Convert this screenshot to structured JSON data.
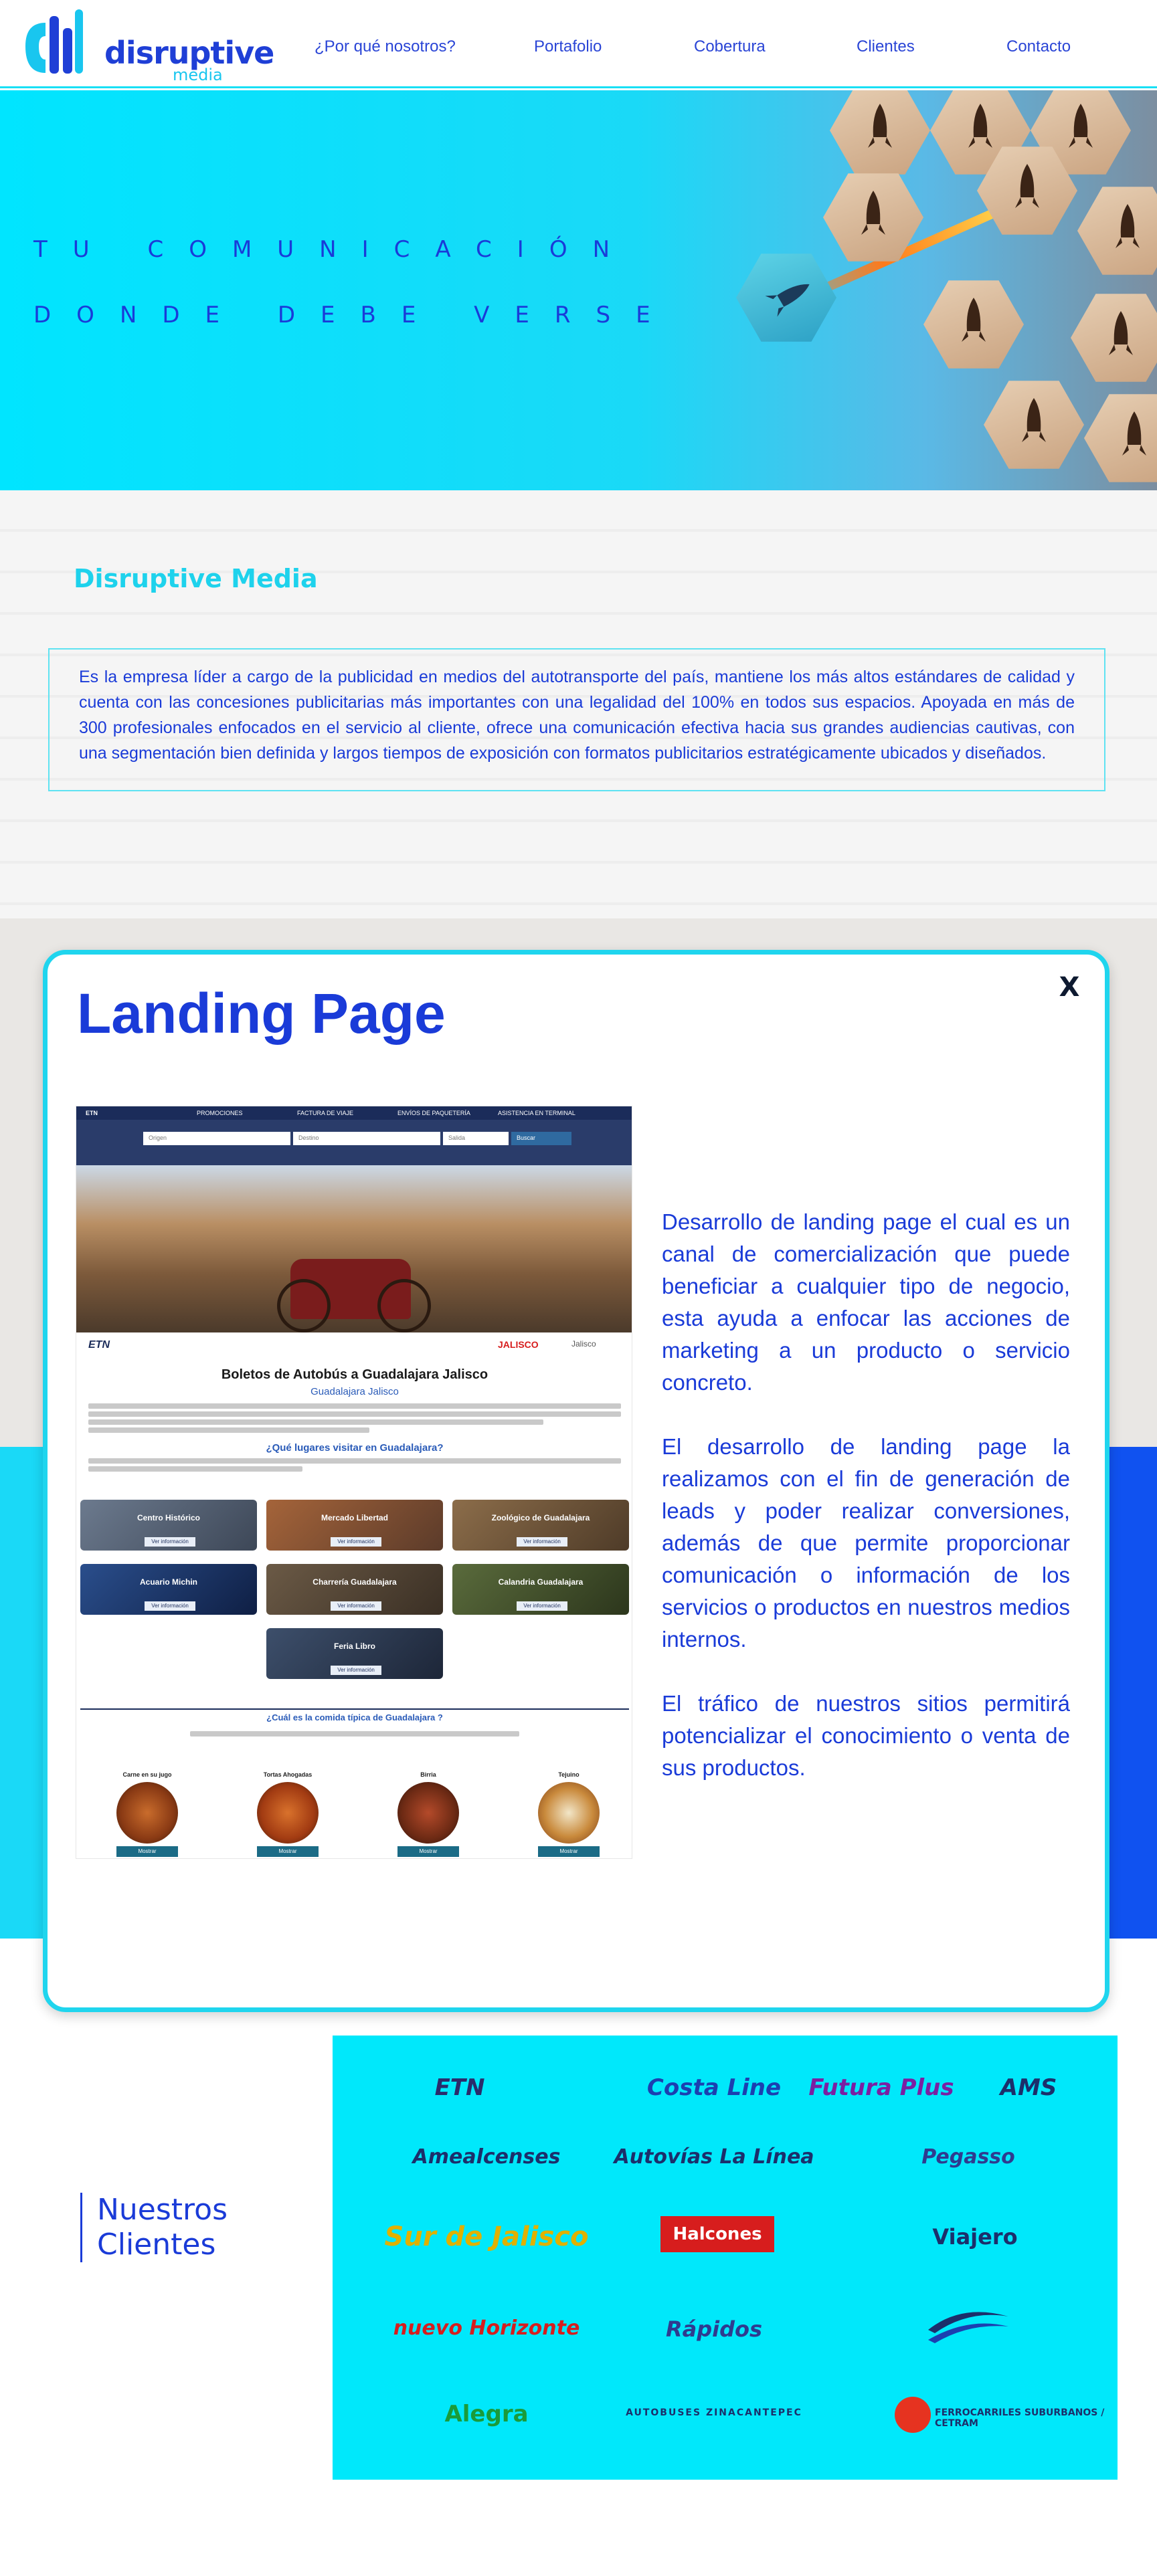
{
  "header": {
    "logo_text": "disruptive",
    "logo_sub": "media",
    "nav": [
      {
        "label": "¿Por qué nosotros?"
      },
      {
        "label": "Portafolio"
      },
      {
        "label": "Cobertura"
      },
      {
        "label": "Clientes"
      },
      {
        "label": "Contacto"
      }
    ]
  },
  "hero": {
    "line1": "TU COMUNICACIÓN",
    "line2": "DONDE DEBE VERSE"
  },
  "about": {
    "title": "Disruptive Media",
    "text": "Es la empresa líder a cargo de la publicidad en medios del autotransporte del país, mantiene los más altos estándares de calidad y cuenta con las concesiones publicitarias más importantes con una legalidad del 100% en todos sus espacios. Apoyada en más de 300 profesionales enfocados en el servicio al cliente, ofrece una comunicación efectiva hacia sus grandes audiencias cautivas, con una segmentación bien definida y largos tiempos de exposición con formatos publicitarios estratégicamente ubicados y diseñados."
  },
  "modal": {
    "close_label": "X",
    "title": "Landing Page",
    "paragraphs": [
      "Desarrollo de landing page el cual es un canal de comercialización que puede beneficiar a cualquier tipo de negocio, esta ayuda a enfocar las acciones de marketing a un producto o servicio concreto.",
      "El desarrollo de landing page la realizamos con el fin de generación de leads y poder realizar conversiones, además de que permite proporcionar comunicación o información de los servicios o productos en nuestros medios internos.",
      "El tráfico de nuestros sitios permitirá potencializar el conocimiento o venta de sus productos."
    ],
    "preview": {
      "brand": "ETN",
      "nav": [
        "PROMOCIONES",
        "FACTURA DE VIAJE",
        "ENVÍOS DE PAQUETERÍA",
        "ASISTENCIA EN TERMINAL"
      ],
      "field_origin": "Origen",
      "field_destination": "Destino",
      "field_date": "Salida",
      "search_button": "Buscar",
      "logo_jalisco": "JALISCO",
      "logo_jalisco2": "Jalisco",
      "heading": "Boletos de Autobús a Guadalajara Jalisco",
      "subheading": "Guadalajara Jalisco",
      "places_heading": "¿Qué lugares visitar en Guadalajara?",
      "more_info_button": "Ver información",
      "places": [
        {
          "name": "Centro Histórico"
        },
        {
          "name": "Mercado Libertad"
        },
        {
          "name": "Zoológico de Guadalajara"
        },
        {
          "name": "Acuario Michin"
        },
        {
          "name": "Charrería Guadalajara"
        },
        {
          "name": "Calandria Guadalajara"
        },
        {
          "name": "Feria Libro"
        }
      ],
      "food_heading": "¿Cuál es la comida típica de Guadalajara ?",
      "dish_button": "Mostrar",
      "dishes": [
        {
          "name": "Carne en su jugo"
        },
        {
          "name": "Tortas Ahogadas"
        },
        {
          "name": "Birria"
        },
        {
          "name": "Tejuino"
        }
      ]
    }
  },
  "clients": {
    "title_line1": "Nuestros",
    "title_line2": "Clientes",
    "logos": [
      {
        "name": "ETN",
        "color": "#2b2b6b"
      },
      {
        "name": "Costa Line",
        "color": "#1c3fb0"
      },
      {
        "name": "Futura Plus",
        "color": "#7b1fa2"
      },
      {
        "name": "AMS",
        "color": "#1c2f6b"
      },
      {
        "name": "Amealcenses",
        "color": "#1c2f6b"
      },
      {
        "name": "Autovías La Línea",
        "color": "#1c2f6b"
      },
      {
        "name": "Pegasso",
        "color": "#2f3b8f"
      },
      {
        "name": "Sur de Jalisco",
        "color": "#e0b000"
      },
      {
        "name": "Halcones",
        "color": "#d71d1d"
      },
      {
        "name": "Viajero",
        "color": "#1c2f6b"
      },
      {
        "name": "nuevo Horizonte",
        "color": "#d71d1d"
      },
      {
        "name": "Rápidos",
        "color": "#2f3b8f"
      },
      {
        "name": "Alegra",
        "color": "#1a9b3a"
      },
      {
        "name": "AUTOBUSES ZINACANTEPEC",
        "color": "#1c2f6b"
      },
      {
        "name": "FERROCARRILES SUBURBANOS / CETRAM",
        "color": "#1c2f6b"
      }
    ]
  },
  "colors": {
    "accent_cyan": "#19e0f5",
    "brand_blue": "#1a3bd8",
    "deep_blue": "#1052f0"
  }
}
